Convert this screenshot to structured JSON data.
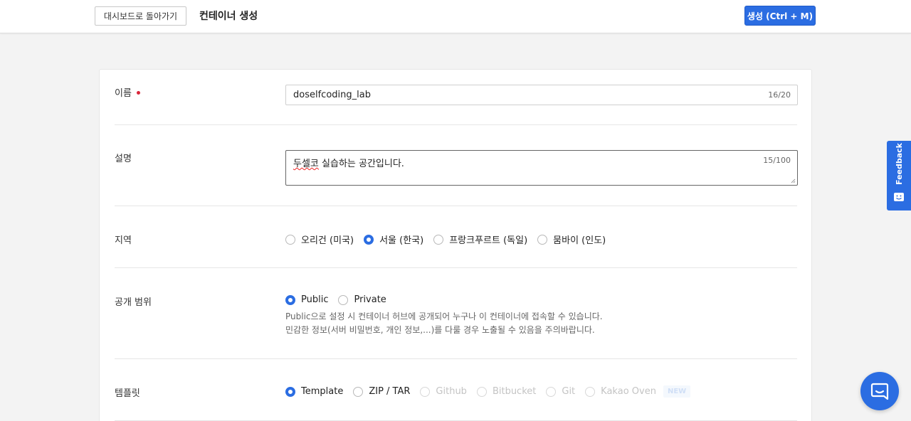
{
  "header": {
    "back_label": "대시보드로 돌아가기",
    "title": "컨테이너 생성",
    "create_label": "생성 (Ctrl + M)"
  },
  "form": {
    "name": {
      "label": "이름",
      "value": "doselfcoding_lab",
      "counter": "16/20"
    },
    "description": {
      "label": "설명",
      "value_marked": "두셀코",
      "value_rest": " 실습하는 공간입니다.",
      "counter": "15/100"
    },
    "region": {
      "label": "지역",
      "options": [
        "오리건 (미국)",
        "서울 (한국)",
        "프랑크푸르트 (독일)",
        "뭄바이 (인도)"
      ],
      "selected": "서울 (한국)"
    },
    "visibility": {
      "label": "공개 범위",
      "options": [
        "Public",
        "Private"
      ],
      "selected": "Public",
      "help_line1": "Public으로 설정 시 컨테이너 허브에 공개되어 누구나 이 컨테이너에 접속할 수 있습니다.",
      "help_line2": "민감한 정보(서버 비밀번호, 개인 정보,...)를 다룰 경우 노출될 수 있음을 주의바랍니다."
    },
    "template": {
      "label": "템플릿",
      "options": [
        "Template",
        "ZIP / TAR",
        "Github",
        "Bitbucket",
        "Git",
        "Kakao Oven"
      ],
      "selected": "Template",
      "badge": "NEW"
    }
  },
  "feedback": {
    "label": "Feedback"
  },
  "colors": {
    "primary": "#2b6de2",
    "required": "#d9263a"
  }
}
